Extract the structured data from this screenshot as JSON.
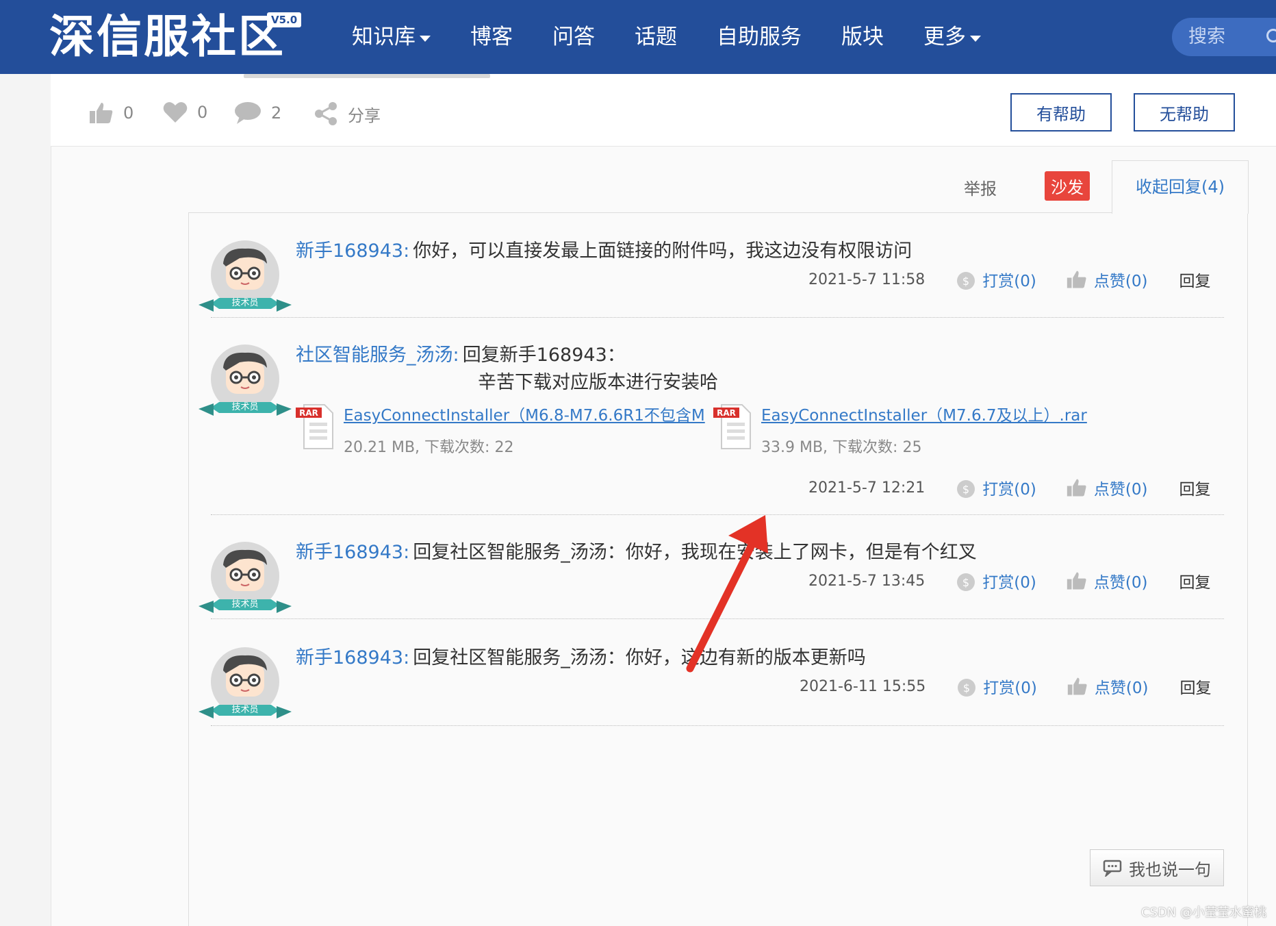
{
  "header": {
    "logo": "深信服社区",
    "version_badge": "V5.0",
    "nav": [
      {
        "label": "知识库",
        "dropdown": true
      },
      {
        "label": "博客",
        "dropdown": false
      },
      {
        "label": "问答",
        "dropdown": false
      },
      {
        "label": "话题",
        "dropdown": false
      },
      {
        "label": "自助服务",
        "dropdown": false
      },
      {
        "label": "版块",
        "dropdown": false
      },
      {
        "label": "更多",
        "dropdown": true
      }
    ],
    "search_placeholder": "搜索"
  },
  "actionbar": {
    "likes": "0",
    "favorites": "0",
    "comments": "2",
    "share_label": "分享",
    "helpful_label": "有帮助",
    "not_helpful_label": "无帮助"
  },
  "reply_tabs": {
    "report_label": "举报",
    "sofa_label": "沙发",
    "collapse_label": "收起回复(4)"
  },
  "avatar_badge": "技术员",
  "replies": [
    {
      "user": "新手168943:",
      "lines": [
        "你好，可以直接发最上面链接的附件吗，我这边没有权限访问"
      ],
      "time": "2021-5-7 11:58",
      "reward": "打赏(0)",
      "like": "点赞(0)",
      "reply": "回复"
    },
    {
      "user": "社区智能服务_汤汤:",
      "lines": [
        "回复新手168943：",
        "辛苦下载对应版本进行安装哈"
      ],
      "attachments": [
        {
          "type": "RAR",
          "name": "EasyConnectInstaller（M6.8-M7.6.6R1不包含M",
          "meta": "20.21 MB, 下载次数: 22"
        },
        {
          "type": "RAR",
          "name": "EasyConnectInstaller（M7.6.7及以上）.rar",
          "meta": "33.9 MB, 下载次数: 25"
        }
      ],
      "time": "2021-5-7 12:21",
      "reward": "打赏(0)",
      "like": "点赞(0)",
      "reply": "回复"
    },
    {
      "user": "新手168943:",
      "lines": [
        "回复社区智能服务_汤汤：你好，我现在安装上了网卡，但是有个红叉"
      ],
      "time": "2021-5-7 13:45",
      "reward": "打赏(0)",
      "like": "点赞(0)",
      "reply": "回复"
    },
    {
      "user": "新手168943:",
      "lines": [
        "回复社区智能服务_汤汤：你好，这边有新的版本更新吗"
      ],
      "time": "2021-6-11 15:55",
      "reward": "打赏(0)",
      "like": "点赞(0)",
      "reply": "回复"
    }
  ],
  "say_button": "我也说一句",
  "watermark": "CSDN @小莹莹水蜜桃",
  "colors": {
    "nav_bg": "#234e9a",
    "link": "#3479c7",
    "sofa": "#e8453c",
    "arrow": "#e33226",
    "badge_ribbon": "#3db3ac"
  }
}
